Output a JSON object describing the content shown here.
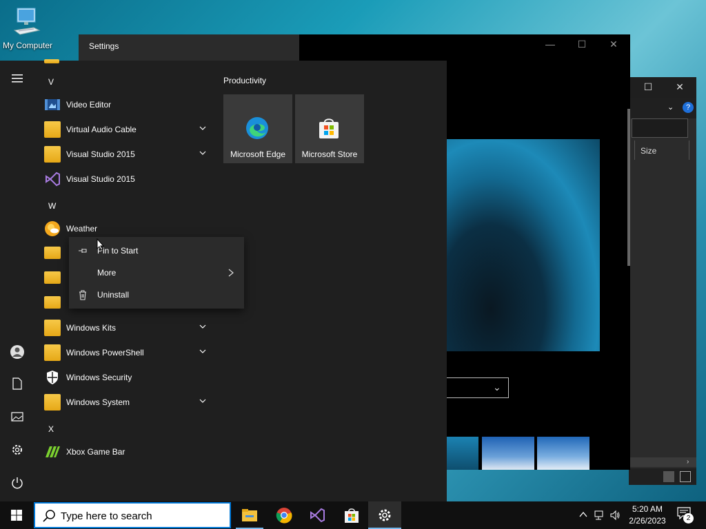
{
  "desktop": {
    "icon_label": "My Computer"
  },
  "explorer": {
    "column_header": "Size"
  },
  "photos": {
    "controls": [
      "minimize",
      "maximize",
      "close"
    ]
  },
  "start_menu": {
    "header_title": "Settings",
    "letters": {
      "v": "V",
      "w": "W",
      "x": "X"
    },
    "apps": [
      {
        "label": "Video Editor",
        "icon": "video-editor-icon"
      },
      {
        "label": "Virtual Audio Cable",
        "icon": "folder-icon",
        "expandable": true
      },
      {
        "label": "Visual Studio 2015",
        "icon": "folder-icon",
        "expandable": true
      },
      {
        "label": "Visual Studio 2015",
        "icon": "visual-studio-icon"
      },
      {
        "label": "Weather",
        "icon": "weather-icon"
      },
      {
        "label": "Windows Kits",
        "icon": "folder-icon",
        "expandable": true
      },
      {
        "label": "Windows PowerShell",
        "icon": "folder-icon",
        "expandable": true
      },
      {
        "label": "Windows Security",
        "icon": "shield-icon"
      },
      {
        "label": "Windows System",
        "icon": "folder-icon",
        "expandable": true
      },
      {
        "label": "Xbox Game Bar",
        "icon": "xbox-game-bar-icon"
      }
    ],
    "group_title": "Productivity",
    "tiles": [
      {
        "label": "Microsoft Edge",
        "icon": "edge-icon"
      },
      {
        "label": "Microsoft Store",
        "icon": "store-icon"
      }
    ],
    "rail": [
      "hamburger-icon",
      "user-icon",
      "documents-icon",
      "pictures-icon",
      "settings-icon",
      "power-icon"
    ]
  },
  "context_menu": {
    "items": [
      {
        "label": "Pin to Start",
        "icon": "pin-icon"
      },
      {
        "label": "More",
        "icon": "",
        "submenu": true
      },
      {
        "label": "Uninstall",
        "icon": "trash-icon"
      }
    ]
  },
  "taskbar": {
    "search_placeholder": "Type here to search",
    "apps": [
      "file-explorer-icon",
      "chrome-icon",
      "visual-studio-icon",
      "store-icon",
      "settings-icon"
    ],
    "clock_time": "5:20 AM",
    "clock_date": "2/26/2023",
    "notification_count": "2"
  },
  "colors": {
    "accent": "#0078d7",
    "start_bg": "#1f1f1f",
    "tile_bg": "#3a3a3a",
    "taskbar_bg": "#101010"
  }
}
